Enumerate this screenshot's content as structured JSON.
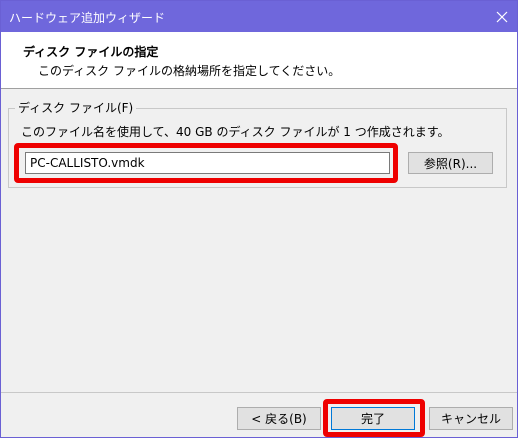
{
  "window": {
    "title": "ハードウェア追加ウィザード"
  },
  "header": {
    "title": "ディスク ファイルの指定",
    "subtitle": "このディスク ファイルの格納場所を指定してください。"
  },
  "disk_file_group": {
    "label": "ディスク ファイル(F)",
    "description": "このファイル名を使用して、40 GB のディスク ファイルが 1 つ作成されます。",
    "path_value": "PC-CALLISTO.vmdk",
    "browse_label": "参照(R)..."
  },
  "footer": {
    "back_label": "< 戻る(B)",
    "finish_label": "完了",
    "cancel_label": "キャンセル"
  },
  "icons": {
    "close": "close-icon"
  },
  "colors": {
    "titlebar": "#6f67dc",
    "highlight": "#ee0000",
    "focus_border": "#0078d7"
  }
}
